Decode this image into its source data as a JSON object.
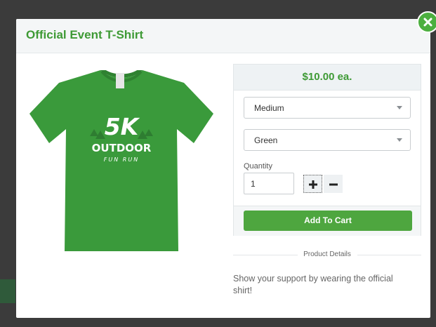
{
  "modal": {
    "title": "Official Event T-Shirt"
  },
  "product": {
    "shirt_color": "#3a9a3b",
    "shirt_text_line1": "5K",
    "shirt_text_line2": "OUTDOOR",
    "shirt_text_line3": "FUN RUN"
  },
  "purchase": {
    "price": "$10.00 ea.",
    "size_select": {
      "value": "Medium"
    },
    "color_select": {
      "value": "Green"
    },
    "quantity": {
      "label": "Quantity",
      "value": "1"
    },
    "add_to_cart_label": "Add To Cart"
  },
  "details": {
    "heading": "Product Details",
    "description": "Show your support by wearing the official shirt!"
  },
  "colors": {
    "accent": "#4ea63f",
    "title": "#3e9a35"
  },
  "icons": {
    "close": "close-icon",
    "plus": "plus-icon",
    "minus": "minus-icon",
    "dropdown": "chevron-down-icon"
  }
}
